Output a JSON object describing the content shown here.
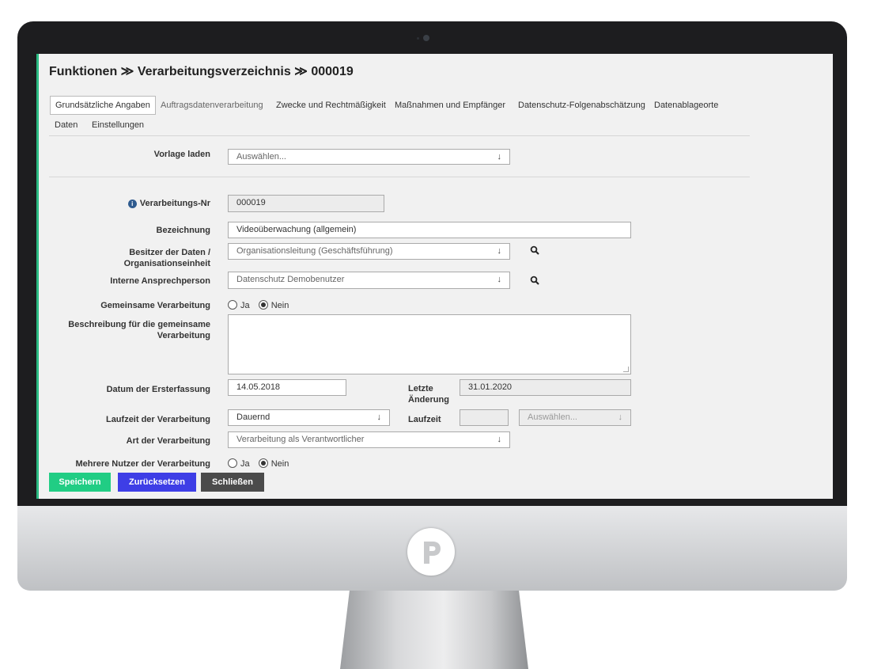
{
  "page": {
    "breadcrumb": "Funktionen ≫ Verarbeitungsverzeichnis ≫ 000019"
  },
  "tabs": [
    {
      "label": "Grundsätzliche Angaben",
      "active": true
    },
    {
      "label": "Auftragsdatenverarbeitung"
    },
    {
      "label": "Zwecke und Rechtmäßigkeit"
    },
    {
      "label": "Maßnahmen und Empfänger"
    },
    {
      "label": "Datenschutz-Folgenabschätzung"
    },
    {
      "label": "Datenablageorte"
    },
    {
      "label": "Daten"
    },
    {
      "label": "Einstellungen"
    }
  ],
  "form": {
    "vorlage": {
      "label": "Vorlage laden",
      "placeholder": "Auswählen..."
    },
    "nr": {
      "label": "Verarbeitungs-Nr",
      "value": "000019"
    },
    "bezeichnung": {
      "label": "Bezeichnung",
      "value": "Videoüberwachung (allgemein)"
    },
    "besitzer": {
      "label_1": "Besitzer der Daten /",
      "label_2": "Organisationseinheit",
      "value": "Organisationsleitung (Geschäftsführung)"
    },
    "ansprech": {
      "label": "Interne Ansprechperson",
      "value": "Datenschutz Demobenutzer"
    },
    "gemeinsam": {
      "label": "Gemeinsame Verarbeitung",
      "options": [
        "Ja",
        "Nein"
      ],
      "selected": "Nein"
    },
    "beschreibung": {
      "label_1": "Beschreibung für die gemeinsame",
      "label_2": "Verarbeitung",
      "value": ""
    },
    "datum": {
      "label": "Datum der Ersterfassung",
      "value": "14.05.2018"
    },
    "letzte": {
      "label_1": "Letzte",
      "label_2": "Änderung",
      "value": "31.01.2020"
    },
    "laufzeit_verarbeitung": {
      "label": "Laufzeit der Verarbeitung",
      "value": "Dauernd"
    },
    "laufzeit": {
      "label": "Laufzeit",
      "value": "",
      "unit_placeholder": "Auswählen..."
    },
    "art": {
      "label": "Art der Verarbeitung",
      "value": "Verarbeitung als Verantwortlicher"
    },
    "mehrere": {
      "label": "Mehrere Nutzer der Verarbeitung",
      "options": [
        "Ja",
        "Nein"
      ],
      "selected": "Nein"
    }
  },
  "buttons": {
    "save": {
      "label": "Speichern",
      "color": "#21cd84"
    },
    "reset": {
      "label": "Zurücksetzen",
      "color": "#3e3ee6"
    },
    "close": {
      "label": "Schließen",
      "color": "#4b4b4b"
    }
  },
  "icons": {
    "dropdown": "arrow-down-icon",
    "search": "search-icon",
    "info": "info-icon"
  }
}
